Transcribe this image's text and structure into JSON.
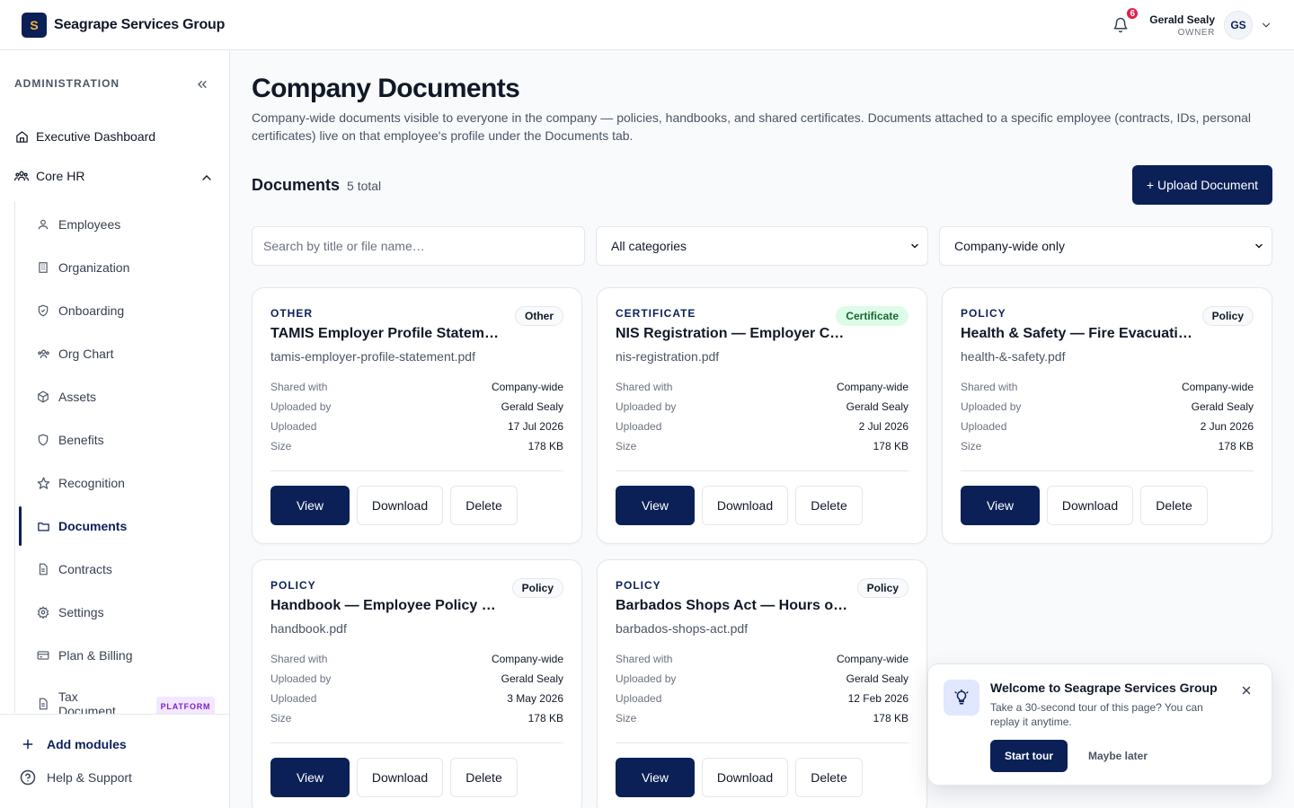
{
  "app": {
    "logo_letter": "S",
    "name": "Seagrape Services Group"
  },
  "header": {
    "notifications_count": "6",
    "user_name": "Gerald Sealy",
    "user_role": "OWNER",
    "user_initials": "GS"
  },
  "sidebar": {
    "section_label": "ADMINISTRATION",
    "top_items": [
      {
        "label": "Executive Dashboard",
        "icon": "home-icon"
      },
      {
        "label": "Core HR",
        "icon": "users-icon"
      }
    ],
    "sub_items": [
      {
        "label": "Employees",
        "icon": "user-icon"
      },
      {
        "label": "Organization",
        "icon": "building-icon"
      },
      {
        "label": "Onboarding",
        "icon": "shield-check-icon"
      },
      {
        "label": "Org Chart",
        "icon": "users-icon"
      },
      {
        "label": "Assets",
        "icon": "box-icon"
      },
      {
        "label": "Benefits",
        "icon": "shield-icon"
      },
      {
        "label": "Recognition",
        "icon": "star-icon"
      },
      {
        "label": "Documents",
        "icon": "folder-icon",
        "active": true
      },
      {
        "label": "Contracts",
        "icon": "file-icon"
      },
      {
        "label": "Settings",
        "icon": "gear-icon"
      },
      {
        "label": "Plan & Billing",
        "icon": "credit-card-icon"
      },
      {
        "label": "Tax Document",
        "icon": "file-icon",
        "badge": "PLATFORM"
      }
    ],
    "add_modules": "Add modules",
    "help": "Help & Support"
  },
  "main": {
    "title": "Company Documents",
    "description": "Company-wide documents visible to everyone in the company — policies, handbooks, and shared certificates. Documents attached to a specific employee (contracts, IDs, personal certificates) live on that employee's profile under the Documents tab.",
    "docs_heading": "Documents",
    "docs_count": "5 total",
    "upload_label": "+ Upload Document",
    "search_placeholder": "Search by title or file name…",
    "category_filter": "All categories",
    "scope_filter": "Company-wide only"
  },
  "meta_labels": {
    "shared": "Shared with",
    "by": "Uploaded by",
    "uploaded": "Uploaded",
    "size": "Size"
  },
  "actions": {
    "view": "View",
    "download": "Download",
    "delete": "Delete"
  },
  "documents": [
    {
      "category": "OTHER",
      "badge": "Other",
      "badge_color": "#f8fafc",
      "title": "TAMIS Employer Profile Statement",
      "file": "tamis-employer-profile-statement.pdf",
      "shared": "Company-wide",
      "by": "Gerald Sealy",
      "uploaded": "17 Jul 2026",
      "size": "178 KB"
    },
    {
      "category": "CERTIFICATE",
      "badge": "Certificate",
      "badge_color": "#dcfce7",
      "title": "NIS Registration — Employer Certificate",
      "file": "nis-registration.pdf",
      "shared": "Company-wide",
      "by": "Gerald Sealy",
      "uploaded": "2 Jul 2026",
      "size": "178 KB"
    },
    {
      "category": "POLICY",
      "badge": "Policy",
      "badge_color": "#f8fafc",
      "title": "Health & Safety — Fire Evacuation Plan",
      "file": "health-&-safety.pdf",
      "shared": "Company-wide",
      "by": "Gerald Sealy",
      "uploaded": "2 Jun 2026",
      "size": "178 KB"
    },
    {
      "category": "POLICY",
      "badge": "Policy",
      "badge_color": "#f8fafc",
      "title": "Handbook — Employee Policy Manual",
      "file": "handbook.pdf",
      "shared": "Company-wide",
      "by": "Gerald Sealy",
      "uploaded": "3 May 2026",
      "size": "178 KB"
    },
    {
      "category": "POLICY",
      "badge": "Policy",
      "badge_color": "#f8fafc",
      "title": "Barbados Shops Act — Hours of Work",
      "file": "barbados-shops-act.pdf",
      "shared": "Company-wide",
      "by": "Gerald Sealy",
      "uploaded": "12 Feb 2026",
      "size": "178 KB"
    }
  ],
  "tour": {
    "title": "Welcome to Seagrape Services Group",
    "text": "Take a 30-second tour of this page? You can replay it anytime.",
    "start": "Start tour",
    "later": "Maybe later"
  },
  "colors": {
    "brand": "#0b2057",
    "accent": "#f5b638",
    "badge_red": "#e11d48"
  }
}
